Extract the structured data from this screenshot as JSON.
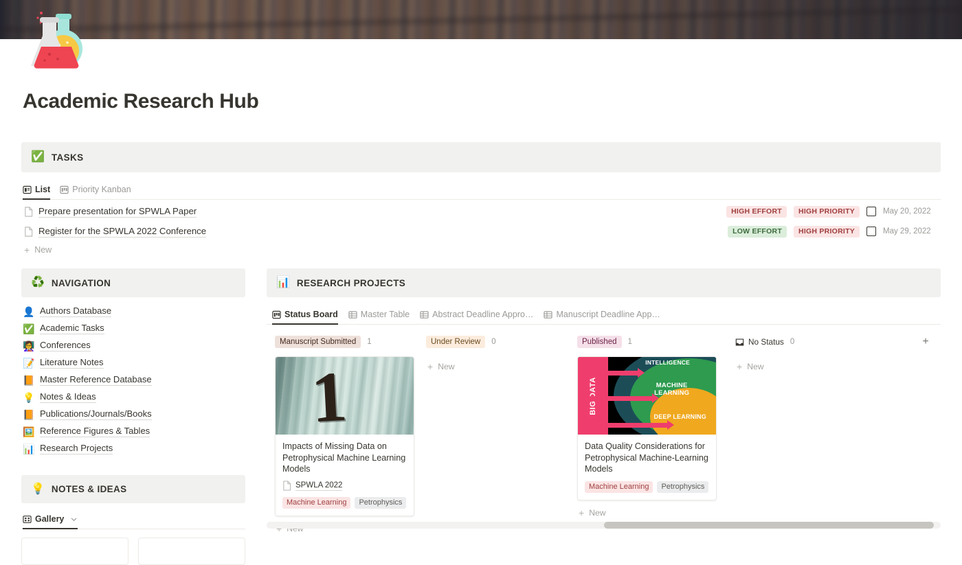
{
  "page": {
    "title": "Academic Research Hub",
    "icon": "lab-flasks-emoji",
    "cover": "blurred-bookshelf-photo"
  },
  "tasks_section": {
    "emoji": "✅",
    "label": "TASKS",
    "views": [
      {
        "label": "List",
        "icon": "list-view-icon",
        "active": true
      },
      {
        "label": "Priority Kanban",
        "icon": "board-view-icon",
        "active": false
      }
    ],
    "rows": [
      {
        "name": "Prepare presentation for SPWLA Paper",
        "effort": "HIGH EFFORT",
        "effort_kind": "high",
        "priority": "HIGH PRIORITY",
        "checked": false,
        "date": "May 20, 2022"
      },
      {
        "name": "Register for the SPWLA 2022 Conference",
        "effort": "LOW EFFORT",
        "effort_kind": "low",
        "priority": "HIGH PRIORITY",
        "checked": false,
        "date": "May 29, 2022"
      }
    ],
    "new_label": "New"
  },
  "navigation_section": {
    "emoji": "♻️",
    "label": "NAVIGATION",
    "items": [
      {
        "emoji": "👤",
        "label": "Authors Database"
      },
      {
        "emoji": "✅",
        "label": "Academic Tasks"
      },
      {
        "emoji": "👩‍🏫",
        "label": "Conferences"
      },
      {
        "emoji": "📝",
        "label": "Literature Notes"
      },
      {
        "emoji": "📙",
        "label": "Master Reference Database"
      },
      {
        "emoji": "💡",
        "label": "Notes & Ideas"
      },
      {
        "emoji": "📙",
        "label": "Publications/Journals/Books"
      },
      {
        "emoji": "🖼️",
        "label": "Reference Figures & Tables"
      },
      {
        "emoji": "📊",
        "label": "Research Projects"
      }
    ]
  },
  "notes_section": {
    "emoji": "💡",
    "label": "NOTES & IDEAS",
    "view": {
      "label": "Gallery",
      "icon": "gallery-view-icon"
    }
  },
  "projects_section": {
    "emoji": "📊",
    "label": "RESEARCH PROJECTS",
    "tabs": [
      {
        "label": "Status Board",
        "icon": "board-view-icon",
        "active": true
      },
      {
        "label": "Master Table",
        "icon": "table-view-icon",
        "active": false
      },
      {
        "label": "Abstract Deadline Appro…",
        "icon": "table-view-icon",
        "active": false
      },
      {
        "label": "Manuscript Deadline App…",
        "icon": "table-view-icon",
        "active": false
      }
    ],
    "columns": [
      {
        "status": "Manuscript Submitted",
        "status_kind": "submitted",
        "count": "1",
        "new_label": "New",
        "cards": [
          {
            "title": "Impacts of Missing Data on Petrophysical Machine Learning Models",
            "cover": "weathered-wall-number-one",
            "relation": "SPWLA 2022",
            "tags": [
              {
                "label": "Machine Learning",
                "kind": "ml"
              },
              {
                "label": "Petrophysics",
                "kind": "petro"
              }
            ]
          }
        ]
      },
      {
        "status": "Under Review",
        "status_kind": "review",
        "count": "0",
        "new_label": "New",
        "cards": []
      },
      {
        "status": "Published",
        "status_kind": "published",
        "count": "1",
        "new_label": "New",
        "cards": [
          {
            "title": "Data Quality Considerations for Petrophysical Machine-Learning Models",
            "cover": "ai-ml-dl-diagram",
            "relation": null,
            "tags": [
              {
                "label": "Machine Learning",
                "kind": "ml"
              },
              {
                "label": "Petrophysics",
                "kind": "petro"
              }
            ]
          }
        ]
      },
      {
        "status": "No Status",
        "status_kind": "none",
        "count": "0",
        "new_label": "New",
        "cards": []
      }
    ],
    "add_group_label": "+"
  },
  "cover_art": {
    "ai_diagram": {
      "big_data": "BIG DATA",
      "intelligence": "INTELLIGENCE",
      "machine_learning": "MACHINE LEARNING",
      "deep_learning": "DEEP LEARNING"
    },
    "wall": {
      "numeral": "1"
    }
  },
  "colors": {
    "accent_red": "#9f3e3e",
    "accent_green": "#3c6b3c",
    "band_bg": "#f1f1ef",
    "text": "#37352f",
    "muted": "#9b9a97"
  }
}
